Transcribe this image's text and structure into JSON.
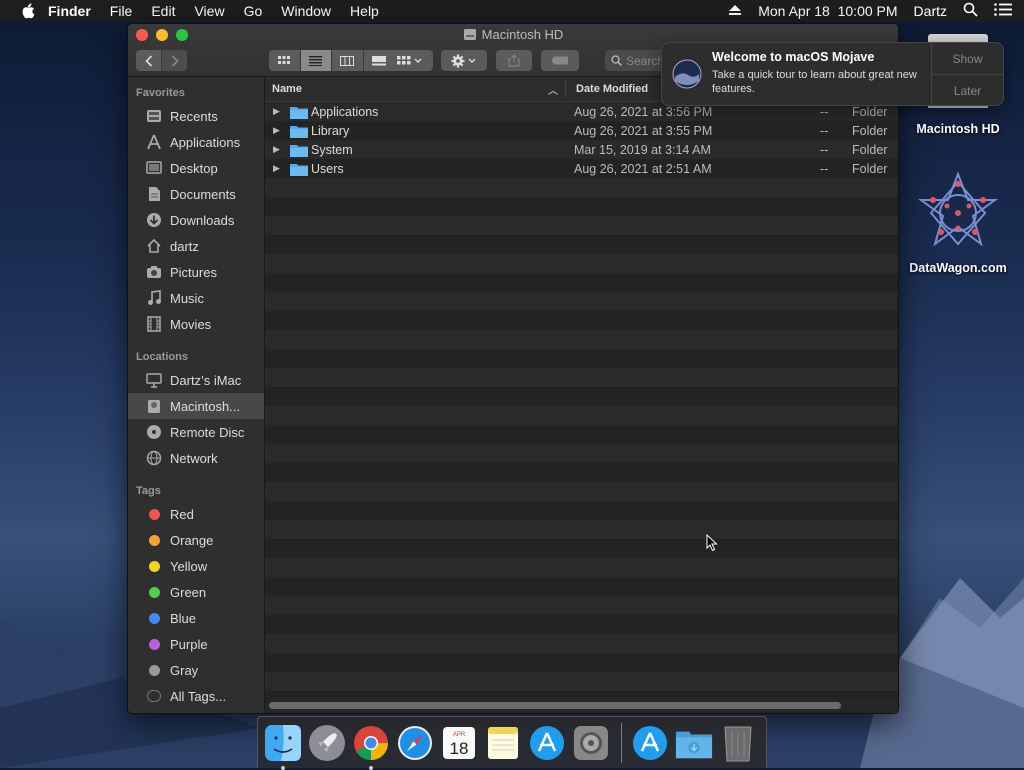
{
  "menubar": {
    "app": "Finder",
    "items": [
      "File",
      "Edit",
      "View",
      "Go",
      "Window",
      "Help"
    ],
    "datetime": "Mon Apr 18  10:00 PM",
    "user": "Dartz"
  },
  "window": {
    "title": "Macintosh HD",
    "search_placeholder": "Search"
  },
  "sidebar": {
    "favorites_label": "Favorites",
    "favorites": [
      "Recents",
      "Applications",
      "Desktop",
      "Documents",
      "Downloads",
      "dartz",
      "Pictures",
      "Music",
      "Movies"
    ],
    "locations_label": "Locations",
    "locations": [
      "Dartz’s iMac",
      "Macintosh...",
      "Remote Disc",
      "Network"
    ],
    "tags_label": "Tags",
    "tags": [
      {
        "name": "Red",
        "color": "#f4524d"
      },
      {
        "name": "Orange",
        "color": "#f5a12d"
      },
      {
        "name": "Yellow",
        "color": "#f3d51e"
      },
      {
        "name": "Green",
        "color": "#4fd049"
      },
      {
        "name": "Blue",
        "color": "#3b8cf5"
      },
      {
        "name": "Purple",
        "color": "#c05ee0"
      },
      {
        "name": "Gray",
        "color": "#9a9a9a"
      }
    ],
    "all_tags": "All Tags..."
  },
  "columns": {
    "name": "Name",
    "date_modified": "Date Modified"
  },
  "files": [
    {
      "name": "Applications",
      "date": "Aug 26, 2021 at 3:56 PM",
      "size": "--",
      "kind": "Folder"
    },
    {
      "name": "Library",
      "date": "Aug 26, 2021 at 3:55 PM",
      "size": "--",
      "kind": "Folder"
    },
    {
      "name": "System",
      "date": "Mar 15, 2019 at 3:14 AM",
      "size": "--",
      "kind": "Folder"
    },
    {
      "name": "Users",
      "date": "Aug 26, 2021 at 2:51 AM",
      "size": "--",
      "kind": "Folder"
    }
  ],
  "notification": {
    "title": "Welcome to macOS Mojave",
    "body": "Take a quick tour to learn about great new features.",
    "show": "Show",
    "later": "Later"
  },
  "desktop": {
    "disk_label": "Macintosh HD",
    "wagon_label": "DataWagon.com"
  },
  "dock": {
    "calendar_month": "APR",
    "calendar_day": "18"
  }
}
